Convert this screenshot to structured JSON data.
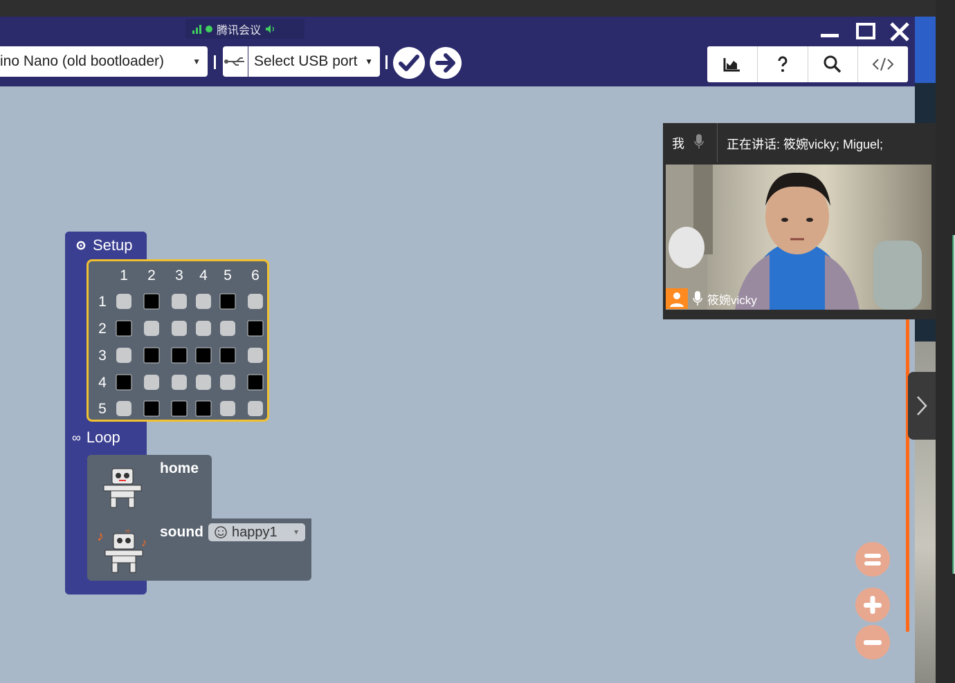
{
  "meeting": {
    "app_name": "腾讯会议"
  },
  "toolbar": {
    "board_label": "ino Nano (old bootloader)",
    "port_label": "Select USB port"
  },
  "blocks": {
    "setup_label": "Setup",
    "loop_label": "Loop",
    "home_label": "home",
    "sound_label": "sound",
    "sound_value": "happy1",
    "matrix": {
      "columns": [
        "1",
        "2",
        "3",
        "4",
        "5",
        "6"
      ],
      "rows": [
        "1",
        "2",
        "3",
        "4",
        "5"
      ],
      "cells": [
        [
          0,
          1,
          0,
          0,
          1,
          0
        ],
        [
          1,
          0,
          0,
          0,
          0,
          1
        ],
        [
          0,
          1,
          1,
          1,
          1,
          0
        ],
        [
          1,
          0,
          0,
          0,
          0,
          1
        ],
        [
          0,
          1,
          1,
          1,
          0,
          0
        ]
      ]
    }
  },
  "video": {
    "self_label": "我",
    "speaking_text": "正在讲话: 筱婉vicky; Miguel;",
    "participant_name": "筱婉vicky"
  },
  "colors": {
    "app_bar": "#2b2a6b",
    "workspace": "#a9b8c8",
    "block_setup": "#3b3f91",
    "block_body": "#5a6470",
    "matrix_outline": "#f0c030",
    "accent_orange": "#ff6a1a"
  }
}
